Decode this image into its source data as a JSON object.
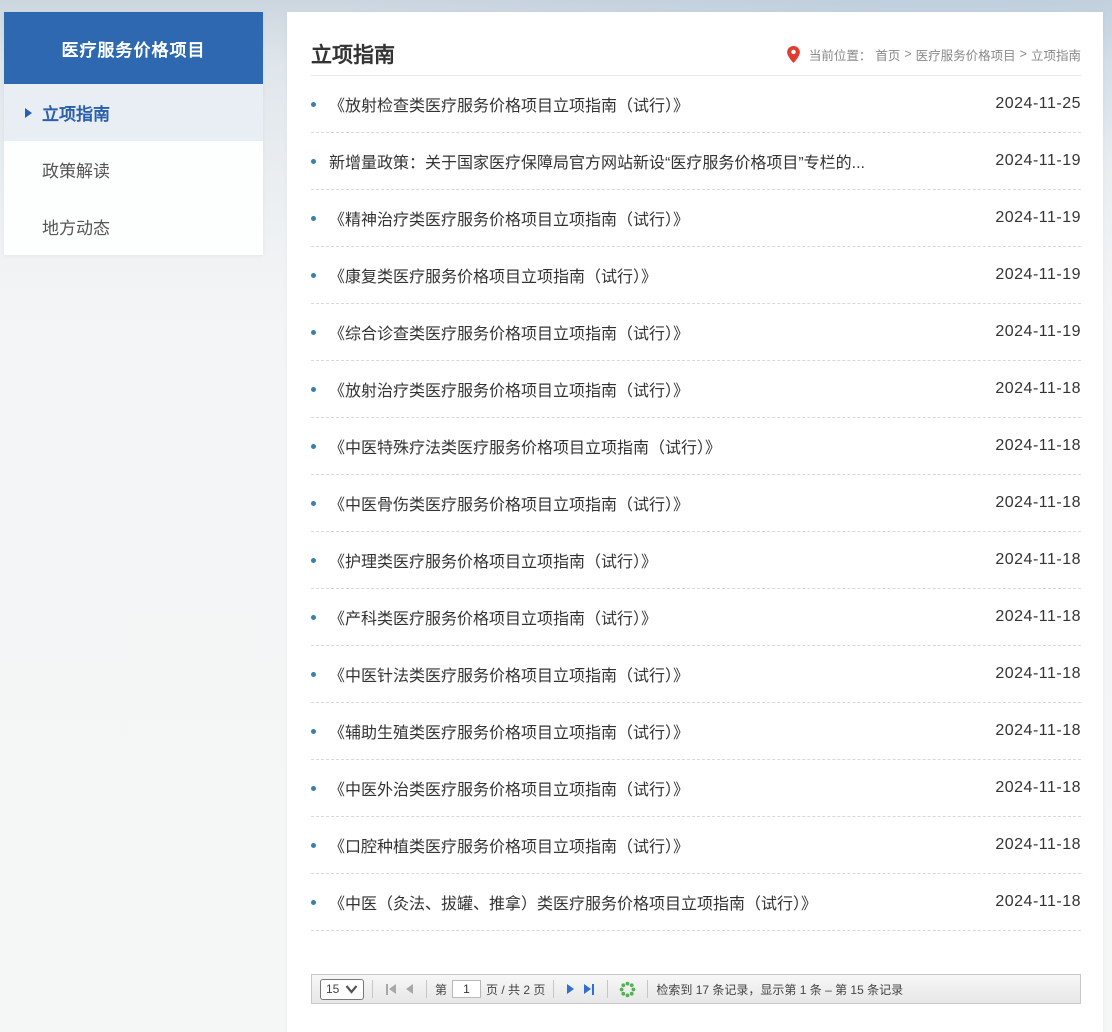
{
  "page": {
    "title": "立项指南"
  },
  "sidebar": {
    "header": "医疗服务价格项目",
    "items": [
      {
        "label": "立项指南"
      },
      {
        "label": "政策解读"
      },
      {
        "label": "地方动态"
      }
    ]
  },
  "breadcrumb": {
    "label": "当前位置：",
    "sep": ">",
    "items": [
      "首页",
      "医疗服务价格项目",
      "立项指南"
    ]
  },
  "list": {
    "items": [
      {
        "title": "《放射检查类医疗服务价格项目立项指南（试行）》",
        "date": "2024-11-25"
      },
      {
        "title": "新增量政策：关于国家医疗保障局官方网站新设“医疗服务价格项目”专栏的...",
        "date": "2024-11-19"
      },
      {
        "title": "《精神治疗类医疗服务价格项目立项指南（试行）》",
        "date": "2024-11-19"
      },
      {
        "title": "《康复类医疗服务价格项目立项指南（试行）》",
        "date": "2024-11-19"
      },
      {
        "title": "《综合诊查类医疗服务价格项目立项指南（试行）》",
        "date": "2024-11-19"
      },
      {
        "title": "《放射治疗类医疗服务价格项目立项指南（试行）》",
        "date": "2024-11-18"
      },
      {
        "title": "《中医特殊疗法类医疗服务价格项目立项指南（试行）》",
        "date": "2024-11-18"
      },
      {
        "title": "《中医骨伤类医疗服务价格项目立项指南（试行）》",
        "date": "2024-11-18"
      },
      {
        "title": "《护理类医疗服务价格项目立项指南（试行）》",
        "date": "2024-11-18"
      },
      {
        "title": "《产科类医疗服务价格项目立项指南（试行）》",
        "date": "2024-11-18"
      },
      {
        "title": "《中医针法类医疗服务价格项目立项指南（试行）》",
        "date": "2024-11-18"
      },
      {
        "title": "《辅助生殖类医疗服务价格项目立项指南（试行）》",
        "date": "2024-11-18"
      },
      {
        "title": "《中医外治类医疗服务价格项目立项指南（试行）》",
        "date": "2024-11-18"
      },
      {
        "title": "《口腔种植类医疗服务价格项目立项指南（试行）》",
        "date": "2024-11-18"
      },
      {
        "title": "《中医（灸法、拔罐、推拿）类医疗服务价格项目立项指南（试行）》",
        "date": "2024-11-18"
      }
    ]
  },
  "pagination": {
    "page_size": "15",
    "prefix": "第",
    "current_page": "1",
    "suffix": "页 / 共 2 页",
    "info": "检索到 17 条记录，显示第 1 条 – 第 15 条记录"
  },
  "colors": {
    "accent_blue": "#2d68b0",
    "active_text": "#2a5fae",
    "bullet": "#3a7fae",
    "pin_red": "#e03c31",
    "pager_arrow_blue": "#2f6fd2",
    "reload_green": "#55b055"
  }
}
